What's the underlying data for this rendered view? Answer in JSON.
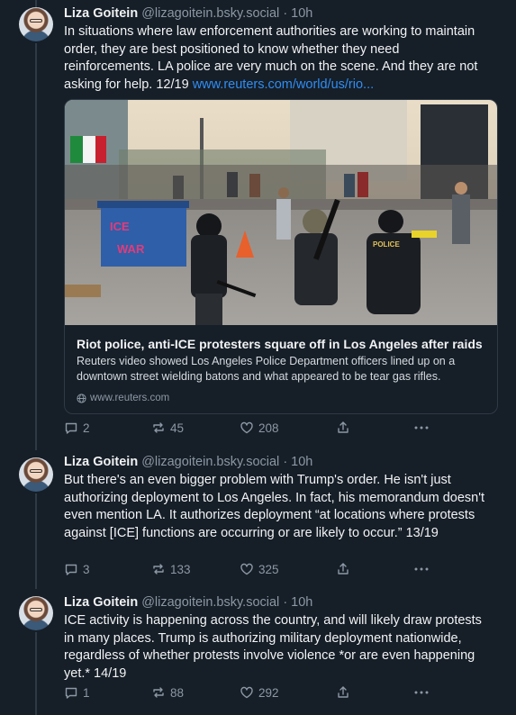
{
  "posts": [
    {
      "author": "Liza Goitein",
      "handle": "@lizagoitein.bsky.social",
      "time": "· 10h",
      "text": "In situations where law enforcement authorities are working to maintain order, they are best positioned to know whether they need reinforcements. LA police are very much on the scene. And they are not asking for help. 12/19 ",
      "link_text": "www.reuters.com/world/us/rio...",
      "card": {
        "title": "Riot police, anti-ICE protesters square off in Los Angeles after raids",
        "description": "Reuters video showed Los Angeles Police Department officers lined up on a downtown street wielding batons and what appeared to be tear gas rifles.",
        "domain": "www.reuters.com",
        "image_signs": {
          "sign_top": "ICE",
          "sign_bottom": "WAR",
          "vest_text": "POLICE"
        }
      },
      "replies": "2",
      "reposts": "45",
      "likes": "208"
    },
    {
      "author": "Liza Goitein",
      "handle": "@lizagoitein.bsky.social",
      "time": "· 10h",
      "text": "But there's an even bigger problem with Trump's order. He isn't just authorizing deployment to Los Angeles. In fact, his memorandum doesn't even mention LA. It authorizes deployment “at locations where protests against [ICE] functions are occurring or are likely to occur.” 13/19",
      "replies": "3",
      "reposts": "133",
      "likes": "325"
    },
    {
      "author": "Liza Goitein",
      "handle": "@lizagoitein.bsky.social",
      "time": "· 10h",
      "text": "ICE activity is happening across the country, and will likely draw protests in many places. Trump is authorizing military deployment nationwide, regardless of whether protests involve violence *or are even happening yet.* 14/19",
      "replies": "1",
      "reposts": "88",
      "likes": "292"
    }
  ],
  "colors": {
    "background": "#161e27",
    "link": "#2f8ef4",
    "muted": "#8b98a5",
    "border": "#2e3a47"
  },
  "icons": [
    "reply-icon",
    "repost-icon",
    "like-icon",
    "share-icon",
    "more-icon",
    "globe-icon"
  ]
}
